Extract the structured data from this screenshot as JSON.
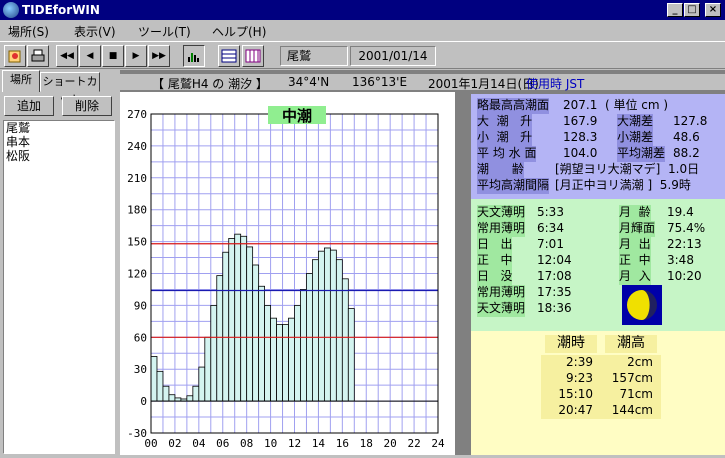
{
  "window": {
    "title": "TIDEforWIN",
    "min": "_",
    "max": "□",
    "close": "×"
  },
  "menu": [
    {
      "label": "場所(S)"
    },
    {
      "label": "表示(V)"
    },
    {
      "label": "ツール(T)"
    },
    {
      "label": "ヘルプ(H)"
    }
  ],
  "toolbar": {
    "location": "尾鷲",
    "date": "2001/01/14",
    "buttons": [
      "◀◀",
      "◀",
      "■",
      "▶",
      "▶▶"
    ]
  },
  "sidebar": {
    "tabs": [
      "場所",
      "ショートカット"
    ],
    "add_label": "追加",
    "delete_label": "削除",
    "places": [
      "尾鷲",
      "串本",
      "松阪"
    ]
  },
  "header": {
    "station": "【 尾鷲H4 の 潮汐 】",
    "lat": "34°4'N",
    "lon": "136°13'E",
    "date": "2001年1月14日(日)",
    "tz": "使用時 JST"
  },
  "chart_data": {
    "type": "bar",
    "title": "中潮",
    "x_tick_labels": [
      "00",
      "02",
      "04",
      "06",
      "08",
      "10",
      "12",
      "14",
      "16",
      "18",
      "20",
      "22",
      "24"
    ],
    "y_tick_labels": [
      "270",
      "240",
      "210",
      "180",
      "150",
      "120",
      "90",
      "60",
      "30",
      "0",
      "-30"
    ],
    "ylim": [
      -30,
      270
    ],
    "xlim": [
      0,
      24
    ],
    "step_hours": 0.5,
    "values": [
      42,
      28,
      14,
      6,
      3,
      2,
      5,
      14,
      32,
      60,
      90,
      118,
      140,
      153,
      157,
      155,
      145,
      128,
      108,
      90,
      78,
      72,
      72,
      78,
      90,
      105,
      120,
      133,
      141,
      144,
      142,
      133,
      115,
      87
    ],
    "hlines": [
      {
        "value": 148,
        "color": "#d81818"
      },
      {
        "value": 104,
        "color": "#1a1ab0"
      },
      {
        "value": 60,
        "color": "#d81818"
      }
    ],
    "grid": true
  },
  "info1": {
    "rows": [
      {
        "a": "略最高高潮面",
        "b": "207.1  ( 単位 cm )"
      },
      {
        "a": "大  潮   升",
        "b": "167.9",
        "c": "大潮差",
        "d": "127.8"
      },
      {
        "a": "小  潮   升",
        "b": "128.3",
        "c": "小潮差",
        "d": "48.6"
      },
      {
        "a": "平 均 水 面",
        "b": "104.0",
        "c": "平均潮差",
        "d": "88.2"
      },
      {
        "a": "潮      齢",
        "b": "[朔望ヨリ大潮マデ]  1.0日"
      },
      {
        "a": "平均高潮間隔",
        "b": "[月正中ヨリ満潮 ]  5.9時"
      }
    ]
  },
  "info2": {
    "left": [
      {
        "a": "天文薄明",
        "b": "5:33"
      },
      {
        "a": "常用薄明",
        "b": "6:34"
      },
      {
        "a": "日   出",
        "b": "7:01"
      },
      {
        "a": "正   中",
        "b": "12:04"
      },
      {
        "a": "日   没",
        "b": "17:08"
      },
      {
        "a": "常用薄明",
        "b": "17:35"
      },
      {
        "a": "天文薄明",
        "b": "18:36"
      }
    ],
    "right": [
      {
        "a": "月  齢",
        "b": "19.4"
      },
      {
        "a": "月輝面",
        "b": "75.4%"
      },
      {
        "a": "月  出",
        "b": "22:13"
      },
      {
        "a": "正  中",
        "b": "3:48"
      },
      {
        "a": "月  入",
        "b": "10:20"
      }
    ],
    "moon_illumination": 0.754
  },
  "info3": {
    "head_time": "潮時",
    "head_height": "潮高",
    "rows": [
      {
        "t": "2:39",
        "h": "2cm"
      },
      {
        "t": "9:23",
        "h": "157cm"
      },
      {
        "t": "15:10",
        "h": "71cm"
      },
      {
        "t": "20:47",
        "h": "144cm"
      }
    ]
  },
  "colors": {
    "titlebar": "#000080",
    "bar_fill": "#d4f4f0",
    "grid": "#a0a0f0",
    "info1": "#b4b4f5",
    "info2": "#c6f5c6",
    "info3": "#fffdc4",
    "moon": "#f0e000",
    "moon_bg": "#0000a8"
  }
}
